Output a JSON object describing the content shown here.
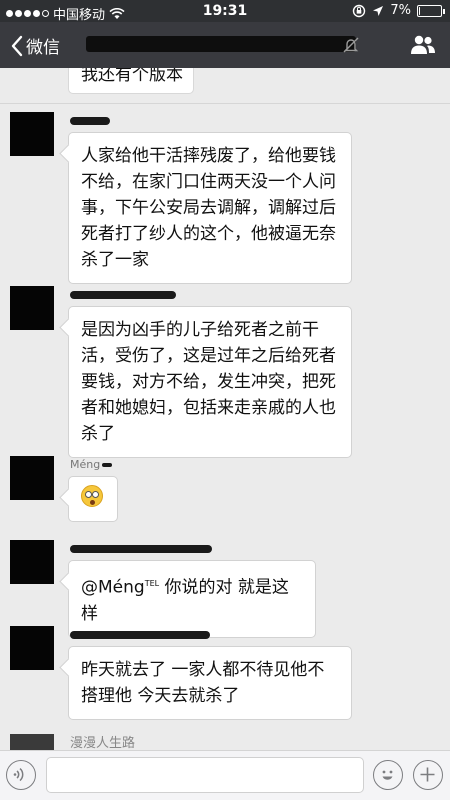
{
  "status_bar": {
    "carrier": "中国移动",
    "time": "19:31",
    "battery": "7%",
    "battery_level": 0.07,
    "icons": [
      "signal-dots-icon",
      "wifi-icon",
      "rotation-lock-icon",
      "location-arrow-icon",
      "battery-icon"
    ]
  },
  "nav": {
    "back_label": "微信",
    "title": "",
    "icons": [
      "back-chevron-icon",
      "mute-icon",
      "group-members-icon"
    ]
  },
  "messages": {
    "prev_fragment": "我还有个版本",
    "m1": {
      "nick": "",
      "text": "人家给他干活摔残废了，给他要钱不给，在家门口住两天没一个人问事，下午公安局去调解，调解过后死者打了纱人的这个，他被逼无奈杀了一家"
    },
    "m2": {
      "nick": "",
      "text": "是因为凶手的儿子给死者之前干活，受伤了，这是过年之后给死者要钱，对方不给，发生冲突，把死者和她媳妇，包括来走亲戚的人也杀了"
    },
    "m3": {
      "nick": "Méng",
      "emoji": "flushed-face-icon"
    },
    "m4": {
      "nick": "",
      "mention": "@Méng",
      "mention_sup": "TEL",
      "text": "你说的对 就是这样"
    },
    "m5": {
      "nick": "",
      "text": "昨天就去了 一家人都不待见他不搭理他 今天去就杀了"
    },
    "next_preview_name": "漫漫人生路"
  },
  "input_bar": {
    "placeholder": "",
    "icons": [
      "voice-icon",
      "emoji-icon",
      "plus-icon"
    ]
  },
  "colors": {
    "nav_bg": "#393a3f",
    "chat_bg": "#ebebeb",
    "bubble_bg": "#ffffff"
  }
}
